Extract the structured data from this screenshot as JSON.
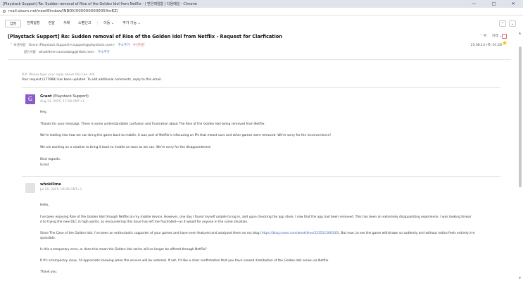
{
  "window": {
    "title": "[Playstack Support] Re: Sudden removal of Rise of the Golden Idol from Netflix - | 받은메일함 | 다음메일 - Chrome",
    "minimize_label": "—",
    "restore_label": "□",
    "close_label": "✕"
  },
  "address_bar": {
    "url": "mail.daum.net/newWindow/INBOX/0000000000054mEZ/"
  },
  "toolbar": {
    "reply": "답장",
    "reply_all": "전체답장",
    "forward": "전달",
    "delete": "삭제",
    "spam": "스팸신고",
    "move": "이동 ⌄",
    "more": "추가 기능 ⌄",
    "prev": "⌃",
    "next": "⌄"
  },
  "message": {
    "subject": "[Playstack Support] Re: Sudden removal of Rise of the Golden Idol from Netflix - Request for Clarfication",
    "nav_up": "⌃ 위",
    "nav_down": "아래 ⌄",
    "from_label": "⌃ 보낸사람",
    "from": "Grant (Playstack Support)<support@playstack.com>",
    "add_address": "주소추가",
    "block": "수신차단",
    "to_label": "받는사람",
    "to": "whokillme<annadang@hibet.net>",
    "add_address_2": "주소추가",
    "date": "25.08.14 (목) 01:28"
  },
  "reply_marker": "##- Please type your reply above this line -##",
  "update_notice": "Your request (177989) has been updated. To add additional comments, reply to this email.",
  "msg1": {
    "avatar_letter": "G",
    "name": "Grant",
    "org": " (Playstack Support)",
    "date": "Aug 13, 2025, 17:28 GMT+1",
    "p1": "Hey,",
    "p2": "Thanks for your message. There is some understandable confusion and frustration about The Rise of the Golden Idol being removed from Netflix.",
    "p3": "We're looking into how we can bring the game back to mobile, it was part of Netflix's refocusing on IPs that meant ours and other games were removed. We're sorry for the inconvenience!",
    "p4": "We are working on a solution to bring it back to mobile as soon as we can. We're sorry for the disappointment.",
    "p5a": "Kind regards,",
    "p5b": "Grant"
  },
  "msg2": {
    "name": "whokillme",
    "date": "Jul 20, 2025, 09:39 GMT+1",
    "p1": "Hello,",
    "p2a": "I've been enjoying Rise of the Golden Idol through Netflix on my mobile device. However, one day I found myself unable to log in, and upon checking the app store, I saw that the app had been removed. This has been an extremely disappointing experience. I was looking forwar",
    "p2b": "d to trying the new DLC in high spirits, so encountering this issue has left me frustrated—as it would for anyone in the same situation.",
    "p3a_pre": "Since The Case of the Golden Idol, I've been an enthusiastic supporter of your games and have even featured and analyzed them on my blog (",
    "p3a_link": "https://blog.naver.com/whokillme/223511560145",
    "p3a_post": "). But now, to see the game withdrawn so suddenly and without notice feels entirely irre",
    "p3b": "sponsible.",
    "p4": "Is this a temporary error, or does this mean the Golden Idol series will no longer be offered through Netflix?",
    "p5": "If it's a temporary issue, I'd appreciate knowing when the service will be restored. If not, I'd like a clear confirmation that you have ceased distribution of the Golden Idol series via Netflix.",
    "p6": "Thank you."
  },
  "icons": {
    "tune": "tune-icon",
    "print": "print-icon",
    "star": "star-icon",
    "star_glyph": "★"
  },
  "colors": {
    "accent": "#3a66c4",
    "avatar": "#8b5bc9",
    "star": "#f2c200",
    "block": "#d9534f"
  }
}
